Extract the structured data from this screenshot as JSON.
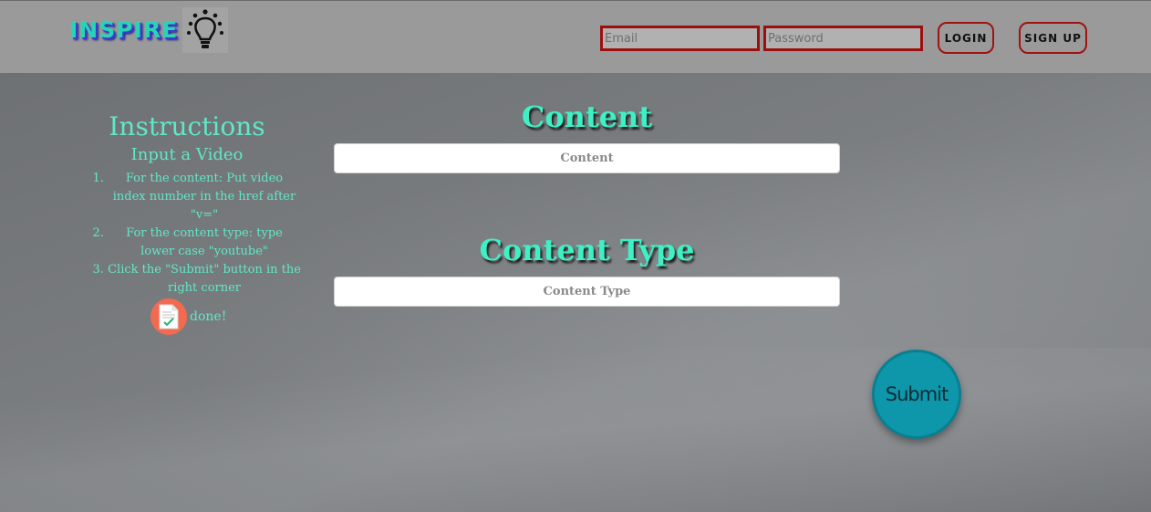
{
  "header": {
    "brand": "INSPIRE",
    "email_placeholder": "Email",
    "password_placeholder": "Password",
    "login_label": "LOGIN",
    "signup_label": "SIGN UP"
  },
  "instructions": {
    "title": "Instructions",
    "subtitle": "Input a Video",
    "steps": [
      "For the content: Put video index number in the href after \"v=\"",
      "For the content type: type lower case \"youtube\"",
      "Click the \"Submit\" button in the right corner"
    ],
    "done_text": "done!"
  },
  "form": {
    "content_heading": "Content",
    "content_placeholder": "Content",
    "content_type_heading": "Content Type",
    "content_type_placeholder": "Content Type",
    "submit_label": "Submit"
  },
  "colors": {
    "accent": "#3ef0c4",
    "button_border": "#a11212",
    "submit": "#0e97ab"
  }
}
